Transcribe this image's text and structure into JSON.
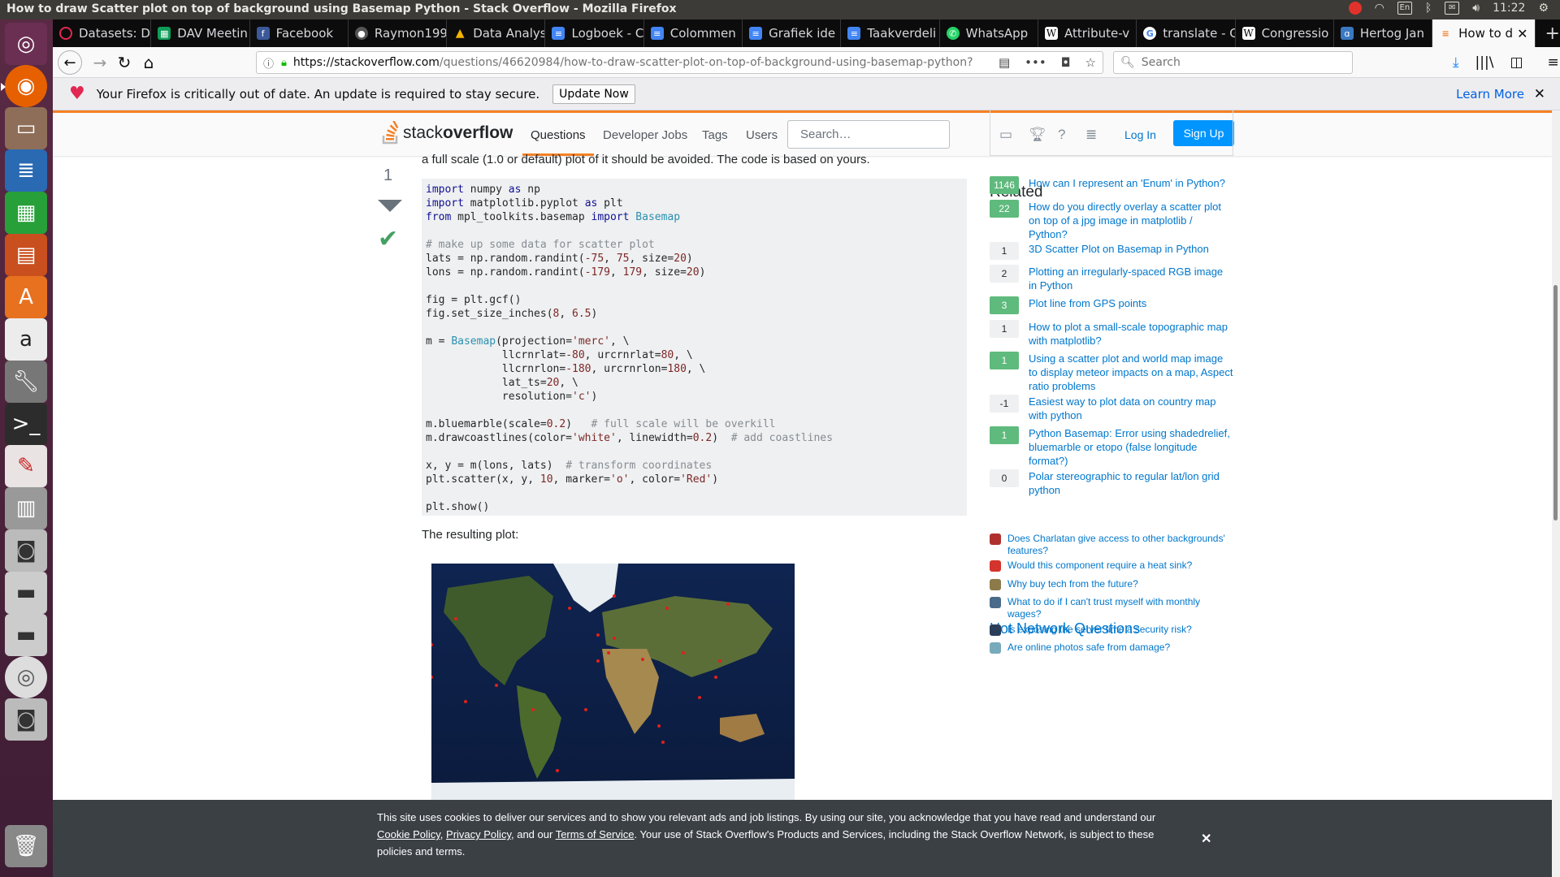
{
  "os": {
    "window_title": "How to draw Scatter plot on top of background using Basemap Python - Stack Overflow - Mozilla Firefox",
    "keyboard_layout": "En",
    "clock": "11:22"
  },
  "launcher": [
    "ubuntu-icon",
    "firefox-icon",
    "files-icon",
    "writer-icon",
    "calc-icon",
    "impress-icon",
    "software-center-icon",
    "amazon-icon",
    "settings-icon",
    "terminal-icon",
    "text-editor-icon",
    "scanner-icon",
    "camera-icon",
    "drive-icon",
    "drive2-icon",
    "dvd-icon",
    "camera2-icon",
    "trash-icon"
  ],
  "tabs": [
    {
      "label": "Datasets: D",
      "icon": "loading-icon",
      "color": "#e22850"
    },
    {
      "label": "DAV Meetin",
      "icon": "sheets-icon",
      "color": "#0f9d58"
    },
    {
      "label": "Facebook",
      "icon": "facebook-icon",
      "color": "#3b5998"
    },
    {
      "label": "Raymon199",
      "icon": "github-icon",
      "color": "#333333"
    },
    {
      "label": "Data Analys",
      "icon": "drive-icon",
      "color": "#f4b400"
    },
    {
      "label": "Logboek - C",
      "icon": "docs-icon",
      "color": "#4285f4"
    },
    {
      "label": "Colommen",
      "icon": "docs-icon",
      "color": "#4285f4"
    },
    {
      "label": "Grafiek ide",
      "icon": "docs-icon",
      "color": "#4285f4"
    },
    {
      "label": "Taakverdeli",
      "icon": "docs-icon",
      "color": "#4285f4"
    },
    {
      "label": "WhatsApp",
      "icon": "whatsapp-icon",
      "color": "#25d366"
    },
    {
      "label": "Attribute-v",
      "icon": "wikipedia-icon",
      "color": "#ffffff"
    },
    {
      "label": "translate - G",
      "icon": "google-icon",
      "color": "#ffffff"
    },
    {
      "label": "Congressio",
      "icon": "wikipedia-icon",
      "color": "#ffffff"
    },
    {
      "label": "Hertog Jan",
      "icon": "site-icon",
      "color": "#3a78c2"
    },
    {
      "label": "How to d",
      "icon": "stackoverflow-icon",
      "color": "#f48024"
    }
  ],
  "navbar": {
    "url_domain": "https://stackoverflow.com",
    "url_path": "/questions/46620984/how-to-draw-scatter-plot-on-top-of-background-using-basemap-python?",
    "search_placeholder": "Search"
  },
  "notification": {
    "message": "Your Firefox is critically out of date. An update is required to stay secure.",
    "button": "Update Now",
    "link": "Learn More"
  },
  "so_header": {
    "logo_light": "stack",
    "logo_bold": "overflow",
    "nav": [
      "Questions",
      "Developer Jobs",
      "Tags",
      "Users"
    ],
    "search_placeholder": "Search…",
    "login": "Log In",
    "signup": "Sign Up"
  },
  "answer": {
    "intro_text": "a full scale (1.0 or default) plot of it should be avoided. The code is based on yours.",
    "votes": "1",
    "resulting_text": "The resulting plot:"
  },
  "code_lines": [
    "import numpy as np",
    "import matplotlib.pyplot as plt",
    "from mpl_toolkits.basemap import Basemap",
    "",
    "# make up some data for scatter plot",
    "lats = np.random.randint(-75, 75, size=20)",
    "lons = np.random.randint(-179, 179, size=20)",
    "",
    "fig = plt.gcf()",
    "fig.set_size_inches(8, 6.5)",
    "",
    "m = Basemap(projection='merc', \\",
    "            llcrnrlat=-80, urcrnrlat=80, \\",
    "            llcrnrlon=-180, urcrnrlon=180, \\",
    "            lat_ts=20, \\",
    "            resolution='c')",
    "",
    "m.bluemarble(scale=0.2)   # full scale will be overkill",
    "m.drawcoastlines(color='white', linewidth=0.2)  # add coastlines",
    "",
    "x, y = m(lons, lats)  # transform coordinates",
    "plt.scatter(x, y, 10, marker='o', color='Red')",
    "",
    "plt.show()"
  ],
  "related": {
    "title": "Related",
    "items": [
      {
        "score": "1146",
        "accepted": true,
        "title": "How can I represent an 'Enum' in Python?"
      },
      {
        "score": "22",
        "accepted": true,
        "title": "How do you directly overlay a scatter plot on top of a jpg image in matplotlib / Python?"
      },
      {
        "score": "1",
        "accepted": false,
        "title": "3D Scatter Plot on Basemap in Python"
      },
      {
        "score": "2",
        "accepted": false,
        "title": "Plotting an irregularly-spaced RGB image in Python"
      },
      {
        "score": "3",
        "accepted": true,
        "title": "Plot line from GPS points"
      },
      {
        "score": "1",
        "accepted": false,
        "title": "How to plot a small-scale topographic map with matplotlib?"
      },
      {
        "score": "1",
        "accepted": true,
        "title": "Using a scatter plot and world map image to display meteor impacts on a map, Aspect ratio problems"
      },
      {
        "score": "-1",
        "accepted": false,
        "title": "Easiest way to plot data on country map with python"
      },
      {
        "score": "1",
        "accepted": true,
        "title": "Python Basemap: Error using shadedrelief, bluemarble or etopo (false longitude format?)"
      },
      {
        "score": "0",
        "accepted": false,
        "title": "Polar stereographic to regular lat/lon grid python"
      }
    ]
  },
  "hot": {
    "title": "Hot Network Questions",
    "items": [
      {
        "title": "Does Charlatan give access to other backgrounds' features?",
        "icon": "rpg-icon",
        "color": "#b03030"
      },
      {
        "title": "Would this component require a heat sink?",
        "icon": "electronics-icon",
        "color": "#d4342b"
      },
      {
        "title": "Why buy tech from the future?",
        "icon": "worldbuilding-icon",
        "color": "#8c7a4a"
      },
      {
        "title": "What to do if I can't trust myself with monthly wages?",
        "icon": "money-icon",
        "color": "#4a6a8a"
      },
      {
        "title": "Is exposing the server time a security risk?",
        "icon": "security-icon",
        "color": "#2a3e5a"
      },
      {
        "title": "Are online photos safe from damage?",
        "icon": "photo-icon",
        "color": "#7ab"
      }
    ]
  },
  "cookie": {
    "line1": "This site uses cookies to deliver our services and to show you relevant ads and job listings. By using our site, you acknowledge that you have read and understand our",
    "cookie_policy": "Cookie Policy",
    "privacy_policy": "Privacy Policy",
    "and_our": ", and our",
    "terms": "Terms of Service",
    "line2": ". Your use of Stack Overflow's Products and Services, including the Stack Overflow Network, is subject to these policies and terms."
  }
}
